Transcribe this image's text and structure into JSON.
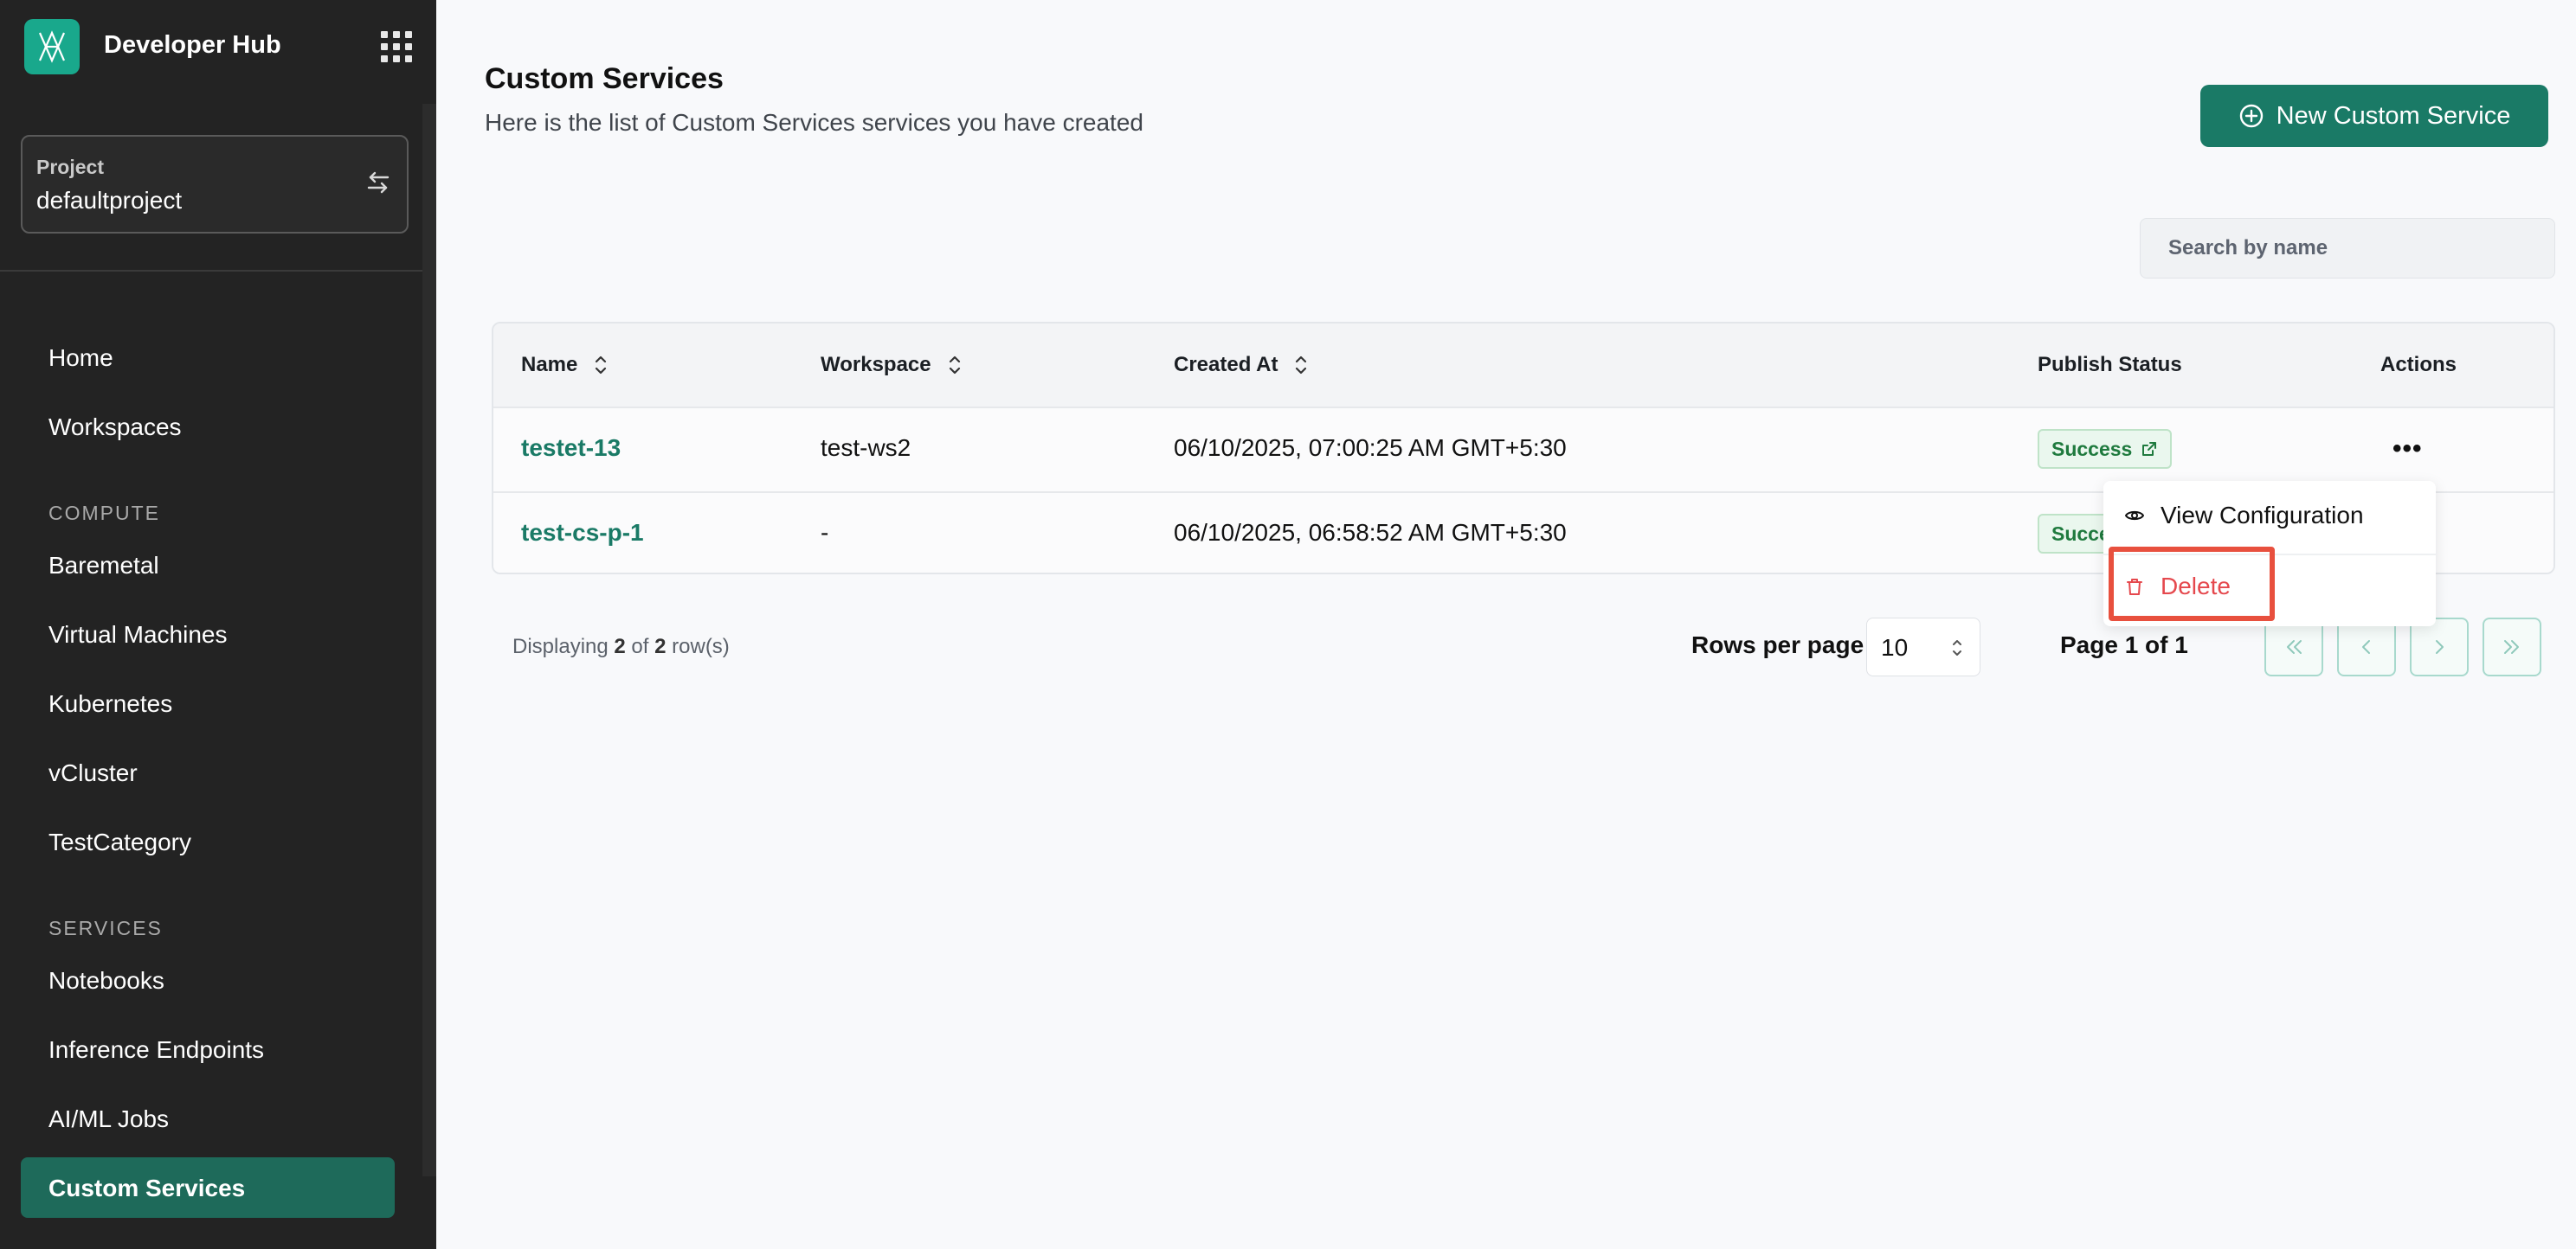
{
  "app": {
    "title": "Developer Hub"
  },
  "project": {
    "label": "Project",
    "value": "defaultproject"
  },
  "sidebar": {
    "items": [
      {
        "label": "Home"
      },
      {
        "label": "Workspaces"
      }
    ],
    "compute_section": "COMPUTE",
    "compute_items": [
      {
        "label": "Baremetal"
      },
      {
        "label": "Virtual Machines"
      },
      {
        "label": "Kubernetes"
      },
      {
        "label": "vCluster"
      },
      {
        "label": "TestCategory"
      }
    ],
    "services_section": "SERVICES",
    "services_items": [
      {
        "label": "Notebooks"
      },
      {
        "label": "Inference Endpoints"
      },
      {
        "label": "AI/ML Jobs"
      },
      {
        "label": "Custom Services",
        "active": true
      }
    ]
  },
  "header": {
    "title": "Custom Services",
    "subtitle": "Here is the list of Custom Services services you have created",
    "new_button": "New Custom Service"
  },
  "search": {
    "placeholder": "Search by name",
    "value": ""
  },
  "table": {
    "columns": [
      "Name",
      "Workspace",
      "Created At",
      "Publish Status",
      "Actions"
    ],
    "rows": [
      {
        "name": "testet-13",
        "workspace": "test-ws2",
        "created_at": "06/10/2025, 07:00:25 AM GMT+5:30",
        "status": "Success"
      },
      {
        "name": "test-cs-p-1",
        "workspace": "-",
        "created_at": "06/10/2025, 06:58:52 AM GMT+5:30",
        "status": "Success"
      }
    ]
  },
  "footer": {
    "display_prefix": "Displaying",
    "shown": "2",
    "of": "of",
    "total": "2",
    "display_suffix": "row(s)",
    "rows_per_page_label": "Rows per page",
    "rows_per_page": "10",
    "page_label": "Page 1 of 1"
  },
  "menu": {
    "view_config": "View Configuration",
    "delete": "Delete"
  },
  "colors": {
    "accent": "#1a7a66",
    "sidebar_bg": "#232323",
    "danger": "#e5484d",
    "highlight": "#e8503e"
  }
}
